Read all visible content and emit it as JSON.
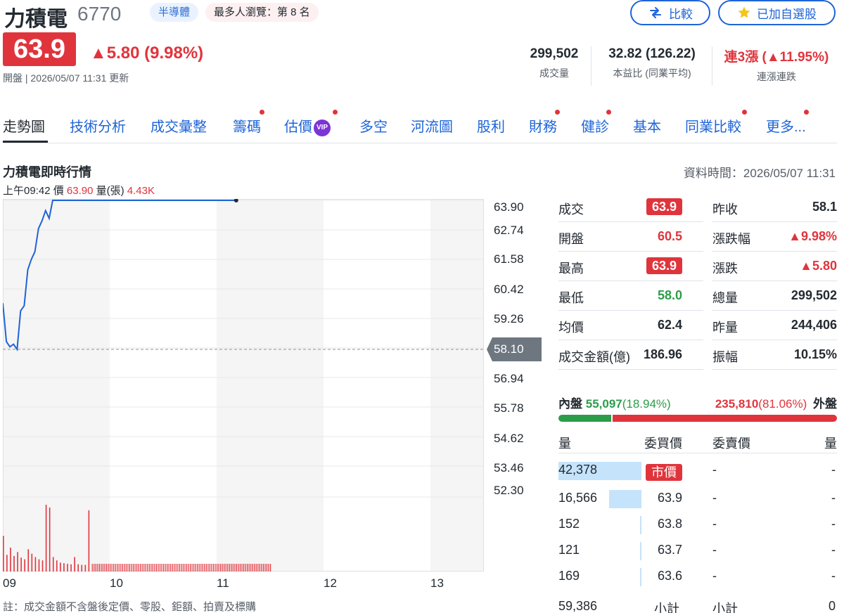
{
  "header": {
    "stock_name": "力積電",
    "stock_code": "6770",
    "tag_sector": "半導體",
    "tag_rank": "最多人瀏覽：第 8 名",
    "compare_label": "比較",
    "watch_label": "已加自選股",
    "price": "63.9",
    "change": "▲5.80 (9.98%)",
    "meta": "開盤 | 2026/05/07 11:31 更新"
  },
  "stats": {
    "volume_val": "299,502",
    "volume_lbl": "成交量",
    "pe_val": "32.82 (126.22)",
    "pe_lbl": "本益比 (同業平均)",
    "streak_val": "連3漲 (▲11.95%)",
    "streak_lbl": "連漲連跌"
  },
  "tabs": [
    {
      "label": "走勢圖"
    },
    {
      "label": "技術分析"
    },
    {
      "label": "成交彙整"
    },
    {
      "label": "籌碼"
    },
    {
      "label": "估價"
    },
    {
      "label": "多空"
    },
    {
      "label": "河流圖"
    },
    {
      "label": "股利"
    },
    {
      "label": "財務"
    },
    {
      "label": "健診"
    },
    {
      "label": "基本"
    },
    {
      "label": "同業比較"
    },
    {
      "label": "更多..."
    }
  ],
  "vip_label": "VIP",
  "section": {
    "title": "力積電即時行情",
    "data_time": "資料時間：2026/05/07 11:31",
    "cursor_time": "上午09:42",
    "cursor_price_lbl": "價",
    "cursor_price": "63.90",
    "cursor_vol_lbl": "量(張)",
    "cursor_vol": "4.43K",
    "prev_close_tag": "58.10",
    "footnote": "註：成交金額不含盤後定價、零股、鉅額、拍賣及標購"
  },
  "chart_data": {
    "type": "line",
    "y_ticks": [
      "63.90",
      "62.74",
      "61.58",
      "60.42",
      "59.26",
      "58.10",
      "56.94",
      "55.78",
      "54.62",
      "53.46",
      "52.30"
    ],
    "x_ticks": [
      "09",
      "10",
      "11",
      "12",
      "13"
    ],
    "ylim": [
      52.3,
      63.9
    ],
    "prev_close": 58.1,
    "x_minutes": [
      0,
      2,
      4,
      6,
      8,
      10,
      12,
      14,
      16,
      18,
      20,
      22,
      24,
      26,
      28,
      30,
      35,
      40,
      45,
      50,
      60,
      70,
      80,
      90,
      100,
      110,
      120,
      131
    ],
    "price": [
      59.9,
      58.4,
      58.2,
      58.3,
      58.1,
      59.6,
      59.8,
      61.2,
      61.6,
      61.9,
      62.8,
      63.1,
      63.5,
      63.2,
      63.9,
      63.9,
      63.9,
      63.9,
      63.9,
      63.9,
      63.9,
      63.9,
      63.9,
      63.9,
      63.9,
      63.9,
      63.9,
      63.9
    ],
    "volume_minutes": [
      0,
      2,
      4,
      6,
      8,
      10,
      12,
      14,
      16,
      18,
      20,
      22,
      24,
      26,
      28,
      30,
      32,
      34,
      36,
      38,
      40,
      42,
      44,
      46,
      48
    ],
    "volume": [
      6.4,
      3.0,
      4.3,
      2.8,
      3.5,
      2.5,
      2.2,
      4.0,
      3.2,
      2.6,
      2.2,
      2.0,
      12.0,
      11.5,
      2.6,
      2.0,
      1.6,
      1.5,
      1.4,
      1.3,
      2.6,
      1.3,
      1.2,
      1.2,
      11.0
    ]
  },
  "quote": {
    "rows": [
      {
        "l1": "成交",
        "v1": "63.9",
        "l2": "昨收",
        "v2": "58.1"
      },
      {
        "l1": "開盤",
        "v1": "60.5",
        "l2": "漲跌幅",
        "v2": "▲9.98%"
      },
      {
        "l1": "最高",
        "v1": "63.9",
        "l2": "漲跌",
        "v2": "▲5.80"
      },
      {
        "l1": "最低",
        "v1": "58.0",
        "l2": "總量",
        "v2": "299,502"
      },
      {
        "l1": "均價",
        "v1": "62.4",
        "l2": "昨量",
        "v2": "244,406"
      },
      {
        "l1": "成交金額(億)",
        "v1": "186.96",
        "l2": "振幅",
        "v2": "10.15%"
      }
    ]
  },
  "flow": {
    "inner_lbl": "內盤",
    "inner_val": "55,097",
    "inner_pct": "(18.94%)",
    "outer_val": "235,810",
    "outer_pct": "(81.06%)",
    "outer_lbl": "外盤",
    "inner_ratio": 0.1894
  },
  "orderbook": {
    "h_qty": "量",
    "h_bid": "委買價",
    "h_ask": "委賣價",
    "h_qty2": "量",
    "rows": [
      {
        "qty": "42,378",
        "bid": "市價",
        "ask": "-",
        "qty2": "-",
        "ratio": 1.0
      },
      {
        "qty": "16,566",
        "bid": "63.9",
        "ask": "-",
        "qty2": "-",
        "ratio": 0.39
      },
      {
        "qty": "152",
        "bid": "63.8",
        "ask": "-",
        "qty2": "-",
        "ratio": 0.004
      },
      {
        "qty": "121",
        "bid": "63.7",
        "ask": "-",
        "qty2": "-",
        "ratio": 0.003
      },
      {
        "qty": "169",
        "bid": "63.6",
        "ask": "-",
        "qty2": "-",
        "ratio": 0.004
      }
    ],
    "total_qty": "59,386",
    "subtotal_lbl": "小計",
    "subtotal_lbl2": "小計",
    "total_qty2": "0"
  },
  "colors": {
    "up": "#e0343c",
    "down": "#2b9d49",
    "link": "#1e64d8",
    "line": "#1e64d8"
  }
}
